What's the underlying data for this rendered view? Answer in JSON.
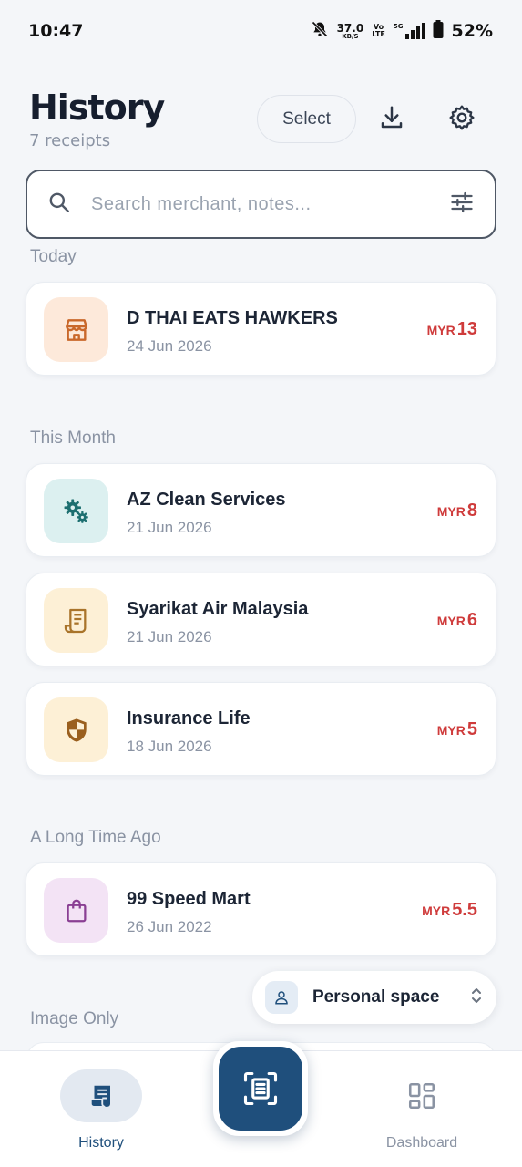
{
  "status": {
    "time": "10:47",
    "net_speed": "37.0",
    "net_speed_unit": "KB/S",
    "volte_top": "Vo",
    "volte_bottom": "LTE",
    "network": "5G",
    "battery": "52%"
  },
  "header": {
    "title": "History",
    "count": "7 receipts",
    "select_label": "Select"
  },
  "search": {
    "placeholder": "Search merchant, notes..."
  },
  "sections": {
    "today": "Today",
    "this_month": "This Month",
    "long_ago": "A Long Time Ago",
    "image_only": "Image Only"
  },
  "receipts": [
    {
      "name": "D THAI EATS HAWKERS",
      "date": "24 Jun 2026",
      "currency": "MYR",
      "amount": "13",
      "icon": "store-icon"
    },
    {
      "name": "AZ Clean Services",
      "date": "21 Jun 2026",
      "currency": "MYR",
      "amount": "8",
      "icon": "gears-icon"
    },
    {
      "name": "Syarikat Air Malaysia",
      "date": "21 Jun 2026",
      "currency": "MYR",
      "amount": "6",
      "icon": "bill-icon"
    },
    {
      "name": "Insurance Life",
      "date": "18 Jun 2026",
      "currency": "MYR",
      "amount": "5",
      "icon": "shield-icon"
    },
    {
      "name": "99 Speed Mart",
      "date": "26 Jun 2022",
      "currency": "MYR",
      "amount": "5.5",
      "icon": "shopping-bag-icon"
    }
  ],
  "space": {
    "label": "Personal space"
  },
  "nav": {
    "history": "History",
    "dashboard": "Dashboard"
  },
  "colors": {
    "primary": "#1f4f7c",
    "amount": "#cf3b3b"
  }
}
